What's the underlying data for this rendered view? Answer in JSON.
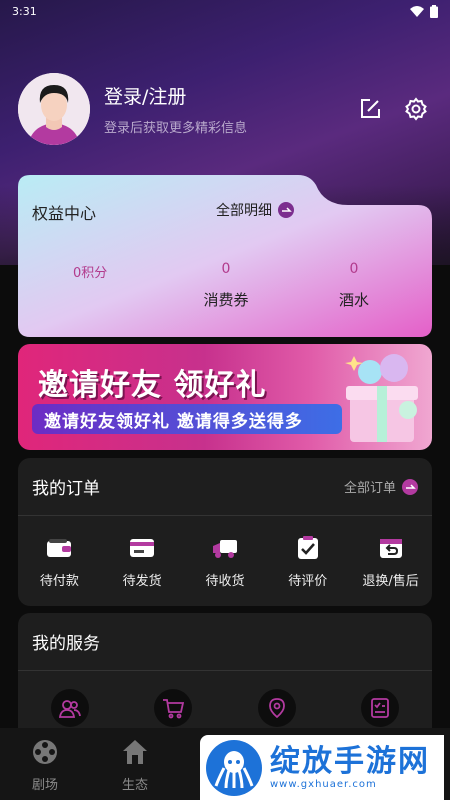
{
  "status_bar": {
    "time": "3:31"
  },
  "profile": {
    "title": "登录/注册",
    "subtitle": "登录后获取更多精彩信息",
    "edit_icon": "edit-icon",
    "settings_icon": "gear-icon"
  },
  "benefits": {
    "title": "权益中心",
    "all_details": "全部明细",
    "points": "0积分",
    "coupons": {
      "value": "0",
      "label": "消费券"
    },
    "drinks": {
      "value": "0",
      "label": "酒水"
    }
  },
  "banner": {
    "headline": "邀请好友 领好礼",
    "subline": "邀请好友领好礼  邀请得多送得多"
  },
  "orders": {
    "title": "我的订单",
    "all": "全部订单",
    "items": [
      {
        "label": "待付款",
        "icon": "wallet-icon"
      },
      {
        "label": "待发货",
        "icon": "card-icon"
      },
      {
        "label": "待收货",
        "icon": "truck-icon"
      },
      {
        "label": "待评价",
        "icon": "check-icon"
      },
      {
        "label": "退换/售后",
        "icon": "return-icon"
      }
    ]
  },
  "services": {
    "title": "我的服务",
    "items": [
      {
        "icon": "users-icon"
      },
      {
        "icon": "cart-icon"
      },
      {
        "icon": "location-icon"
      },
      {
        "icon": "checklist-icon"
      }
    ]
  },
  "tabbar": {
    "items": [
      {
        "label": "剧场",
        "icon": "film-reel-icon"
      },
      {
        "label": "生态",
        "icon": "home-icon"
      }
    ]
  },
  "watermark": {
    "title": "绽放手游网",
    "url": "www.gxhuaer.com"
  },
  "colors": {
    "accent": "#b23a8c",
    "brand_purple": "#5a2a7e",
    "card_bg": "#1e1e1e"
  }
}
